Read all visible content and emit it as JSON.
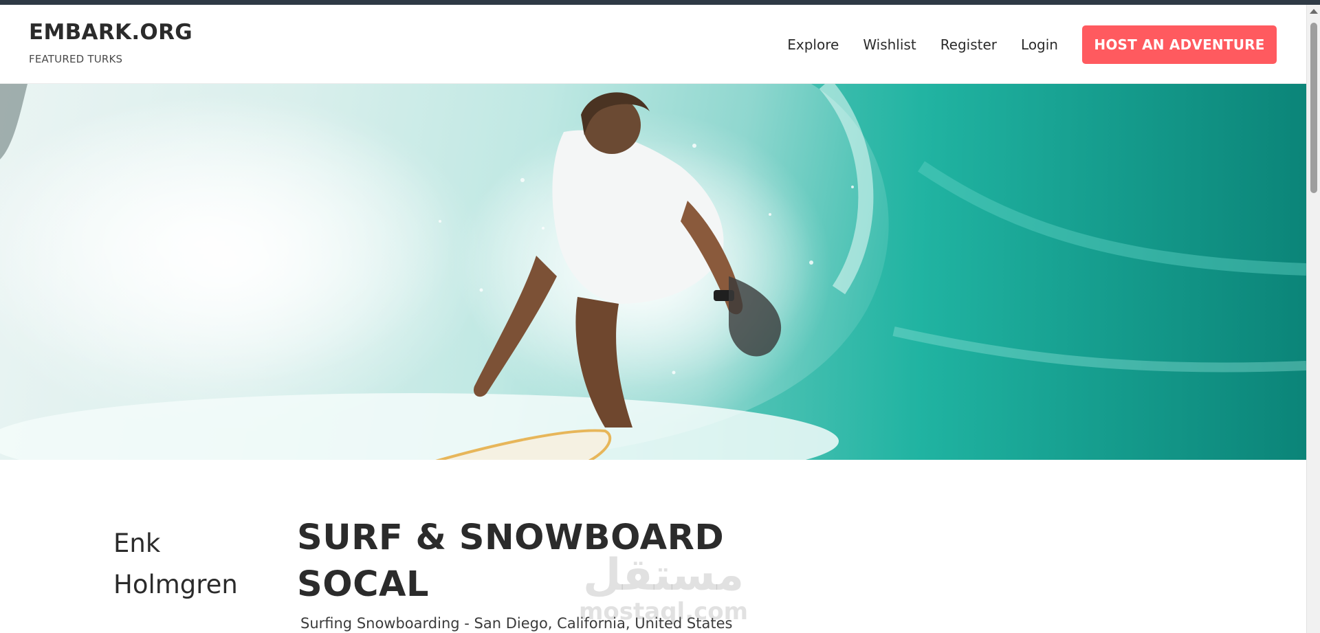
{
  "header": {
    "brand_name": "EMBARK.ORG",
    "brand_tagline": "FEATURED TURKS",
    "nav": [
      "Explore",
      "Wishlist",
      "Register",
      "Login"
    ],
    "cta_label": "HOST AN ADVENTURE"
  },
  "hero": {
    "image_subject": "surfer-in-wave"
  },
  "listing": {
    "host_name": "Enk Holmgren",
    "title": "SURF & SNOWBOARD SOCAL",
    "subtitle": "Surfing Snowboarding - San Diego, California, United States"
  },
  "watermark": {
    "arabic": "مستقل",
    "latin": "mostaql.com"
  },
  "colors": {
    "accent": "#ff5a5f",
    "top_strip": "#2f3a45",
    "text": "#2b2b2b"
  }
}
